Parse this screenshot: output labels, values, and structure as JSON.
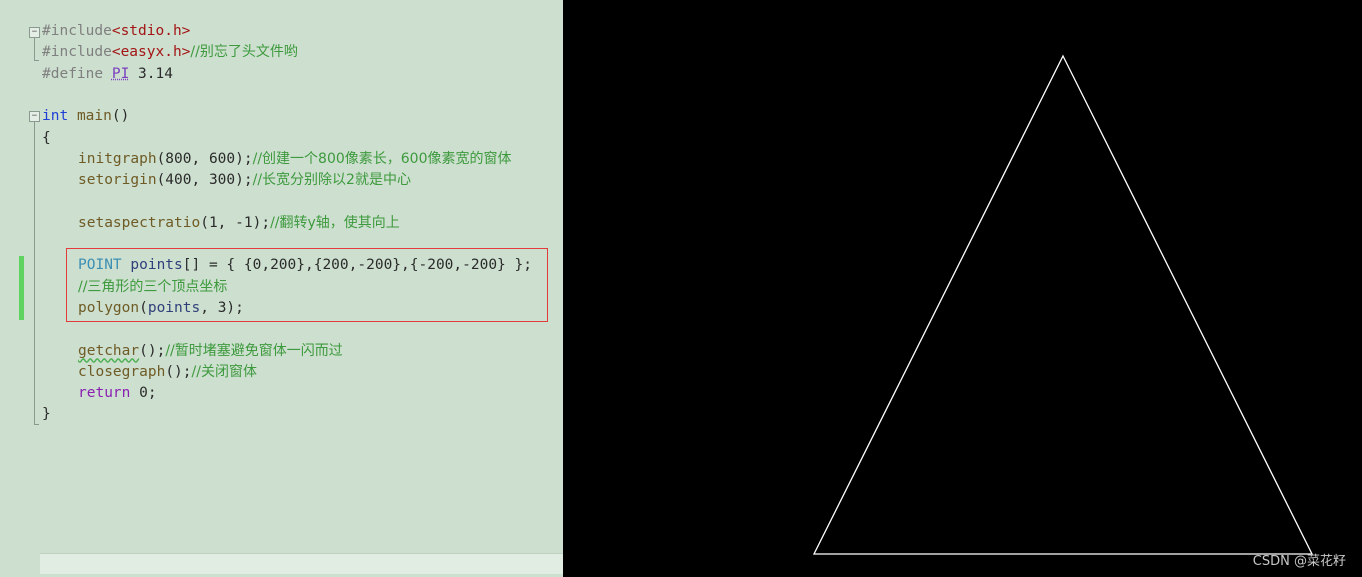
{
  "editor": {
    "lines": [
      {
        "row": 1,
        "indent": 0,
        "tokens": [
          {
            "t": "#include",
            "c": "tok-pre"
          },
          {
            "t": "<stdio.h>",
            "c": "tok-str"
          }
        ]
      },
      {
        "row": 2,
        "indent": 0,
        "tokens": [
          {
            "t": "#include",
            "c": "tok-pre"
          },
          {
            "t": "<easyx.h>",
            "c": "tok-str"
          },
          {
            "t": "//别忘了头文件哟",
            "c": "tok-cmt"
          }
        ]
      },
      {
        "row": 3,
        "indent": 0,
        "tokens": [
          {
            "t": "#define ",
            "c": "tok-pre"
          },
          {
            "t": "PI",
            "c": "tok-macro"
          },
          {
            "t": " 3.14",
            "c": ""
          }
        ]
      },
      {
        "row": 5,
        "indent": 0,
        "tokens": [
          {
            "t": "int",
            "c": "tok-kw"
          },
          {
            "t": " ",
            "c": ""
          },
          {
            "t": "main",
            "c": "tok-fn"
          },
          {
            "t": "()",
            "c": ""
          }
        ]
      },
      {
        "row": 6,
        "indent": 0,
        "tokens": [
          {
            "t": "{",
            "c": ""
          }
        ]
      },
      {
        "row": 7,
        "indent": 1,
        "tokens": [
          {
            "t": "initgraph",
            "c": "tok-fn"
          },
          {
            "t": "(800, 600);",
            "c": ""
          },
          {
            "t": "//创建一个800像素长，600像素宽的窗体",
            "c": "tok-cmt"
          }
        ]
      },
      {
        "row": 8,
        "indent": 1,
        "tokens": [
          {
            "t": "setorigin",
            "c": "tok-fn"
          },
          {
            "t": "(400, 300);",
            "c": ""
          },
          {
            "t": "//长宽分别除以2就是中心",
            "c": "tok-cmt"
          }
        ]
      },
      {
        "row": 10,
        "indent": 1,
        "tokens": [
          {
            "t": "setaspectratio",
            "c": "tok-fn"
          },
          {
            "t": "(1, -1);",
            "c": ""
          },
          {
            "t": "//翻转y轴，使其向上",
            "c": "tok-cmt"
          }
        ]
      },
      {
        "row": 12,
        "indent": 1,
        "tokens": [
          {
            "t": "POINT",
            "c": "tok-type"
          },
          {
            "t": " ",
            "c": ""
          },
          {
            "t": "points",
            "c": "tok-var"
          },
          {
            "t": "[] = { {0,200},{200,-200},{-200,-200} };",
            "c": ""
          }
        ]
      },
      {
        "row": 13,
        "indent": 1,
        "tokens": [
          {
            "t": "//三角形的三个顶点坐标",
            "c": "tok-cmt"
          }
        ]
      },
      {
        "row": 14,
        "indent": 1,
        "tokens": [
          {
            "t": "polygon",
            "c": "tok-fn"
          },
          {
            "t": "(",
            "c": ""
          },
          {
            "t": "points",
            "c": "tok-var"
          },
          {
            "t": ", 3);",
            "c": ""
          }
        ]
      },
      {
        "row": 16,
        "indent": 1,
        "tokens": [
          {
            "t": "getchar",
            "c": "tok-fn tok-squiggle"
          },
          {
            "t": "();",
            "c": ""
          },
          {
            "t": "//暂时堵塞避免窗体一闪而过",
            "c": "tok-cmt"
          }
        ]
      },
      {
        "row": 17,
        "indent": 1,
        "tokens": [
          {
            "t": "closegraph",
            "c": "tok-fn"
          },
          {
            "t": "();",
            "c": ""
          },
          {
            "t": "//关闭窗体",
            "c": "tok-cmt"
          }
        ]
      },
      {
        "row": 18,
        "indent": 1,
        "tokens": [
          {
            "t": "return",
            "c": "tok-ret"
          },
          {
            "t": " 0;",
            "c": ""
          }
        ]
      },
      {
        "row": 19,
        "indent": 0,
        "tokens": [
          {
            "t": "}",
            "c": ""
          }
        ]
      }
    ]
  },
  "graphics": {
    "background": "#000000",
    "stroke": "#ffffff",
    "triangle_points": [
      [
        0,
        200
      ],
      [
        200,
        -200
      ],
      [
        -200,
        -200
      ]
    ]
  },
  "watermark": "CSDN @菜花籽"
}
